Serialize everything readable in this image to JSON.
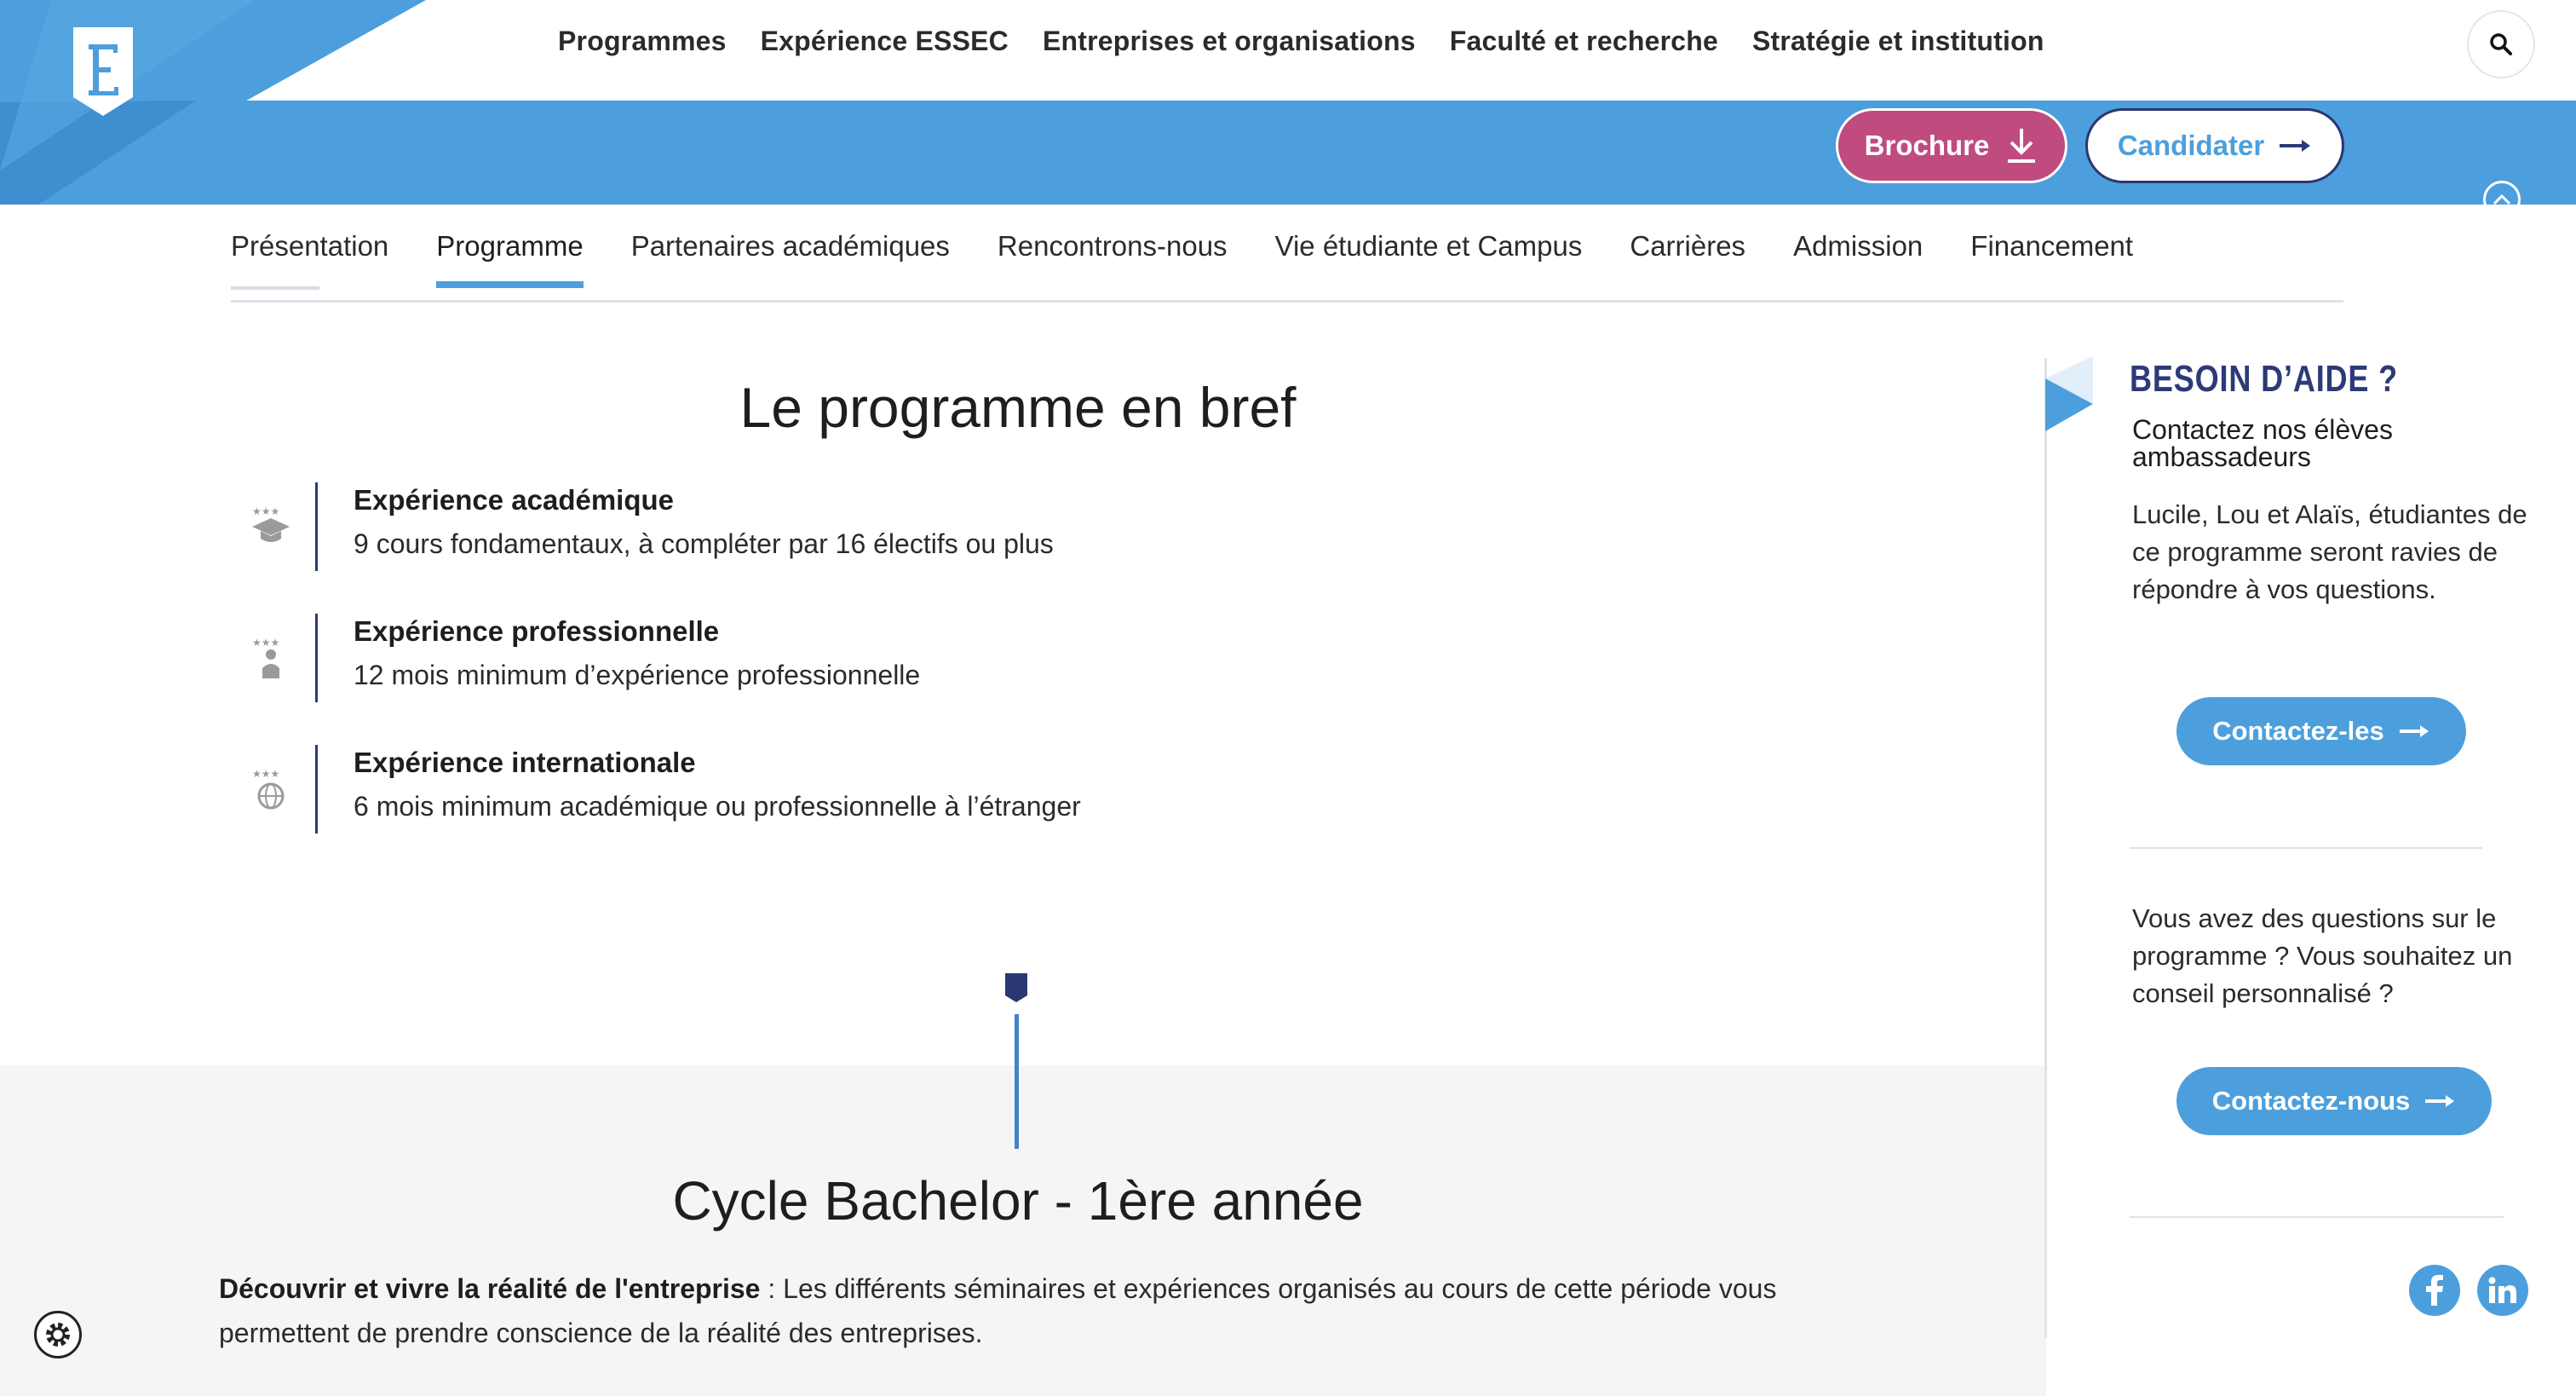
{
  "colors": {
    "brand_blue": "#4c9fdc",
    "navy": "#2d3a78",
    "brochure_pink": "#c04b7f",
    "gray_section": "#f5f5f5"
  },
  "header": {
    "logo_icon": "essec-e-shield",
    "nav": [
      "Programmes",
      "Expérience ESSEC",
      "Entreprises et organisations",
      "Faculté et recherche",
      "Stratégie et institution"
    ],
    "search_icon": "search-icon",
    "brochure_label": "Brochure",
    "candidater_label": "Candidater"
  },
  "subnav": {
    "items": [
      "Présentation",
      "Programme",
      "Partenaires académiques",
      "Rencontrons-nous",
      "Vie étudiante et Campus",
      "Carrières",
      "Admission",
      "Financement"
    ],
    "active": "Programme"
  },
  "main": {
    "title": "Le programme en bref",
    "features": [
      {
        "icon": "graduation-cap-stars-icon",
        "title": "Expérience académique",
        "desc": "9 cours fondamentaux, à compléter par 16 électifs ou plus"
      },
      {
        "icon": "person-stars-icon",
        "title": "Expérience professionnelle",
        "desc": "12 mois minimum d’expérience professionnelle"
      },
      {
        "icon": "globe-stars-icon",
        "title": "Expérience internationale",
        "desc": "6 mois minimum académique ou professionnelle à l’étranger"
      }
    ],
    "section_title": "Cycle Bachelor - 1ère année",
    "paragraph_bold": "Découvrir et vivre la réalité de l'entreprise",
    "paragraph_rest": " : Les différents séminaires et expériences organisés au cours de cette période vous permettent de prendre conscience de la réalité des entreprises."
  },
  "sidebar": {
    "title": "BESOIN D’AIDE ?",
    "subtitle": "Contactez nos élèves ambassadeurs",
    "text": "Lucile, Lou et Alaïs, étudiantes de ce programme seront ravies de répondre à vos questions.",
    "button1": "Contactez-les",
    "text2": "Vous avez des questions sur le programme ? Vous souhaitez un conseil personnalisé ?",
    "button2": "Contactez-nous",
    "social": [
      "facebook-icon",
      "linkedin-icon"
    ]
  }
}
